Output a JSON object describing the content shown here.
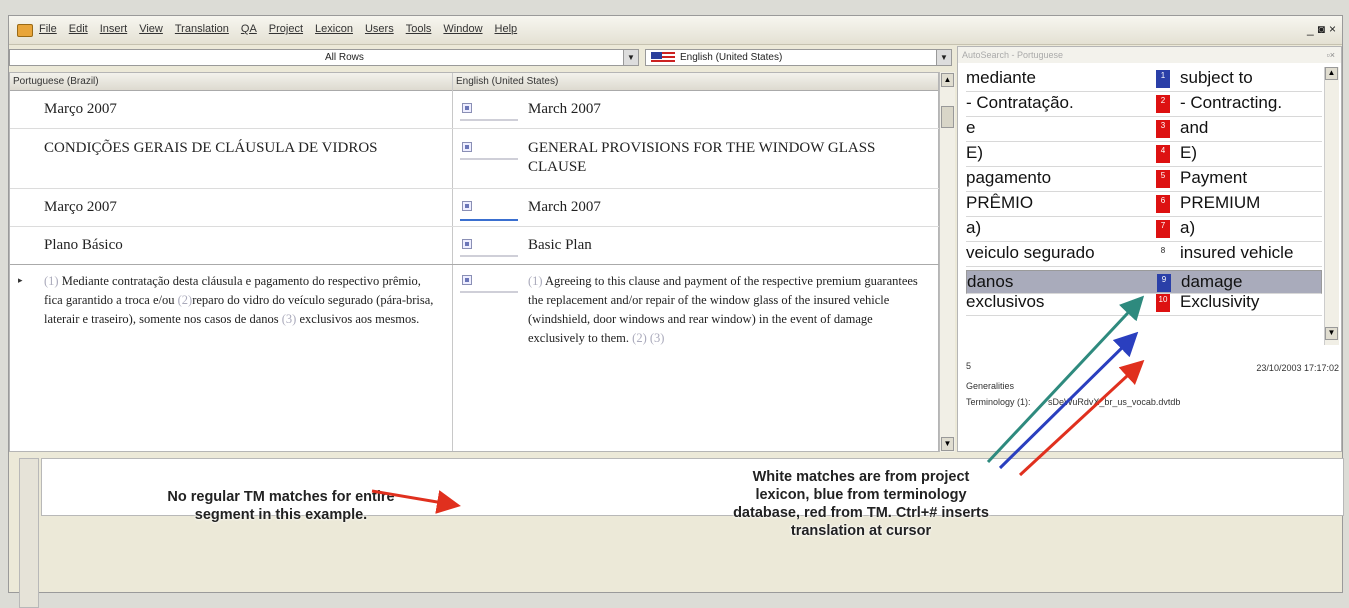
{
  "menu": [
    "File",
    "Edit",
    "Insert",
    "View",
    "Translation",
    "QA",
    "Project",
    "Lexicon",
    "Users",
    "Tools",
    "Window",
    "Help"
  ],
  "window_controls": [
    "_",
    "◙",
    "×"
  ],
  "toolbar": {
    "filter_value": "All Rows",
    "language_value": "English (United States)"
  },
  "grid": {
    "source_header": "Portuguese (Brazil)",
    "target_header": "English (United States)",
    "rows": [
      {
        "source": "Março 2007",
        "target": "March 2007"
      },
      {
        "source": "CONDIÇÕES GERAIS DE CLÁUSULA DE VIDROS",
        "target": "GENERAL PROVISIONS FOR THE WINDOW GLASS CLAUSE"
      },
      {
        "source": "Março 2007",
        "target": "March 2007"
      },
      {
        "source": "Plano Básico",
        "target": "Basic Plan"
      }
    ],
    "active_row": {
      "marker": "▸",
      "source_parts": [
        {
          "t": "(1)",
          "tag": true
        },
        {
          "t": " Mediante contratação desta cláusula e pagamento do respectivo prêmio, fica garantido a troca e/ou "
        },
        {
          "t": "(2)",
          "tag": true
        },
        {
          "t": "reparo do vidro do veículo segurado (pára-brisa, laterair e traseiro), somente nos casos de danos "
        },
        {
          "t": "(3)",
          "tag": true
        },
        {
          "t": " exclusivos aos mesmos."
        }
      ],
      "target_parts": [
        {
          "t": "(1)",
          "tag": true
        },
        {
          "t": " Agreeing to this clause and payment of the respective premium guarantees the replacement and/or repair of the window glass of the insured vehicle (windshield, door windows and rear window) in the event of damage exclusively to them. "
        },
        {
          "t": "(2) (3)",
          "tag": true
        }
      ]
    }
  },
  "autosearch": {
    "title": "AutoSearch - Portuguese",
    "rows": [
      {
        "left": "mediante",
        "num": "1",
        "right": "subject to",
        "color": "#2a3fa8"
      },
      {
        "left": "- Contratação.",
        "num": "2",
        "right": "- Contracting.",
        "color": "#d11"
      },
      {
        "left": "e",
        "num": "3",
        "right": "and",
        "color": "#d11"
      },
      {
        "left": "E)",
        "num": "4",
        "right": "E)",
        "color": "#d11"
      },
      {
        "left": "pagamento",
        "num": "5",
        "right": "Payment",
        "color": "#d11"
      },
      {
        "left": "PRÊMIO",
        "num": "6",
        "right": "PREMIUM",
        "color": "#d11"
      },
      {
        "left": "a)",
        "num": "7",
        "right": "a)",
        "color": "#d11"
      },
      {
        "left": "veiculo segurado",
        "num": "8",
        "right": "insured vehicle",
        "color": "#ffffff"
      },
      {
        "left": "danos",
        "num": "9",
        "right": "damage",
        "color": "#2a3fa8",
        "selected": true
      },
      {
        "left": "exclusivos",
        "num": "10",
        "right": "Exclusivity",
        "color": "#d11"
      }
    ],
    "meta": {
      "count": "5",
      "datetime": "23/10/2003 17:17:02",
      "category": "Generalities",
      "db_label": "Terminology (1):",
      "db_file": "sDeWuRdvX_br_us_vocab.dvtdb"
    }
  },
  "annotations": {
    "left": "No regular TM matches for entire segment in this example.",
    "right": "White matches are from project lexicon, blue from terminology database, red from TM. Ctrl+# inserts translation at cursor"
  },
  "colors": {
    "teal_arrow": "#2e8a7e",
    "blue_arrow": "#2a3fbf",
    "red_arrow": "#e0301e"
  }
}
